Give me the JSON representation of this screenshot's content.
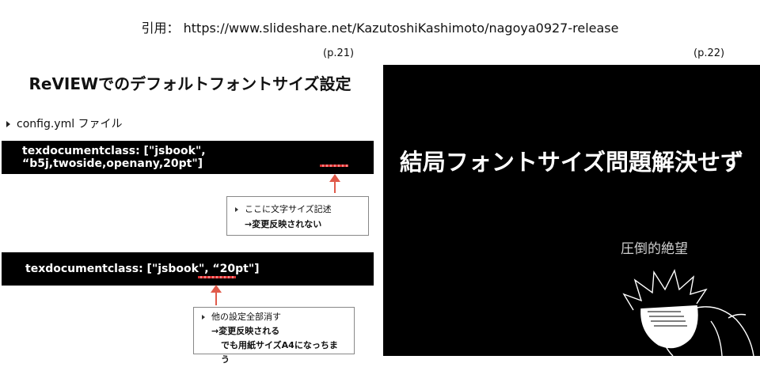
{
  "source": {
    "label": "引用：",
    "url": "https://www.slideshare.net/KazutoshiKashimoto/nagoya0927-release"
  },
  "left_slide": {
    "page": "(p.21)",
    "title": "ReVIEWでのデフォルトフォントサイズ設定",
    "bullet": "config.yml ファイル",
    "code1": "texdocumentclass: [\"jsbook\", “b5j,twoside,openany,20pt\"]",
    "callout1": {
      "line1": "ここに文字サイズ記述",
      "line2": "→変更反映されない"
    },
    "code2": "texdocumentclass: [\"jsbook\", “20pt\"]",
    "callout2": {
      "line1": "他の設定全部消す",
      "line2": "→変更反映される",
      "line3": "でも用紙サイズA4になっちまう"
    }
  },
  "right_slide": {
    "page": "(p.22)",
    "headline": "結局フォントサイズ問題解決せず",
    "caption": "圧倒的絶望"
  },
  "colors": {
    "accent": "#e05a4a",
    "slide_dark": "#000000",
    "text": "#111111"
  }
}
